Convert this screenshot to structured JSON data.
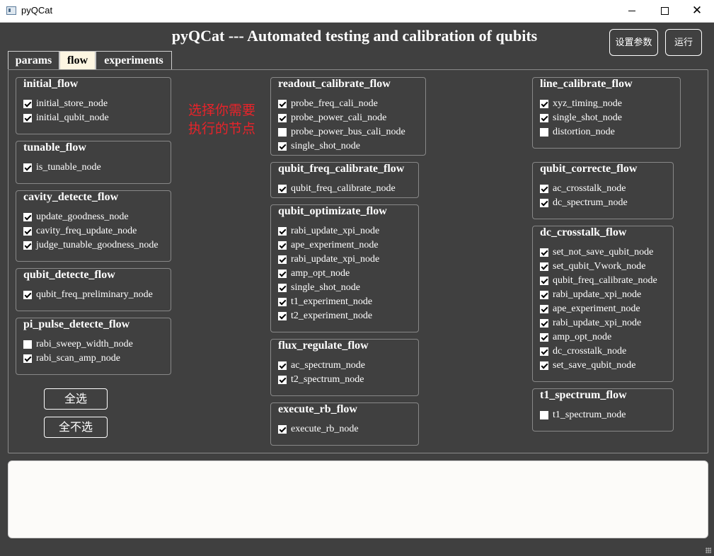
{
  "window": {
    "title": "pyQCat"
  },
  "header": {
    "title": "pyQCat --- Automated testing and calibration of qubits"
  },
  "toolbar": {
    "settings_label": "设置参数",
    "run_label": "运行"
  },
  "tabs": [
    {
      "label": "params",
      "active": false
    },
    {
      "label": "flow",
      "active": true
    },
    {
      "label": "experiments",
      "active": false
    }
  ],
  "hint_text": "选择你需要执行的节点",
  "buttons": {
    "select_all": "全选",
    "select_none": "全不选"
  },
  "groups": {
    "initial_flow": {
      "title": "initial_flow",
      "items": [
        {
          "label": "initial_store_node",
          "checked": true
        },
        {
          "label": "initial_qubit_node",
          "checked": true
        }
      ]
    },
    "tunable_flow": {
      "title": "tunable_flow",
      "items": [
        {
          "label": "is_tunable_node",
          "checked": true
        }
      ]
    },
    "cavity_detecte_flow": {
      "title": "cavity_detecte_flow",
      "items": [
        {
          "label": "update_goodness_node",
          "checked": true
        },
        {
          "label": "cavity_freq_update_node",
          "checked": true
        },
        {
          "label": "judge_tunable_goodness_node",
          "checked": true
        }
      ]
    },
    "qubit_detecte_flow": {
      "title": "qubit_detecte_flow",
      "items": [
        {
          "label": "qubit_freq_preliminary_node",
          "checked": true
        }
      ]
    },
    "pi_pulse_detecte_flow": {
      "title": "pi_pulse_detecte_flow",
      "items": [
        {
          "label": "rabi_sweep_width_node",
          "checked": false
        },
        {
          "label": "rabi_scan_amp_node",
          "checked": true
        }
      ]
    },
    "readout_calibrate_flow": {
      "title": "readout_calibrate_flow",
      "items": [
        {
          "label": "probe_freq_cali_node",
          "checked": true
        },
        {
          "label": "probe_power_cali_node",
          "checked": true
        },
        {
          "label": "probe_power_bus_cali_node",
          "checked": false
        },
        {
          "label": "single_shot_node",
          "checked": true
        }
      ]
    },
    "qubit_freq_calibrate_flow": {
      "title": "qubit_freq_calibrate_flow",
      "items": [
        {
          "label": "qubit_freq_calibrate_node",
          "checked": true
        }
      ]
    },
    "qubit_optimizate_flow": {
      "title": "qubit_optimizate_flow",
      "items": [
        {
          "label": "rabi_update_xpi_node",
          "checked": true
        },
        {
          "label": "ape_experiment_node",
          "checked": true
        },
        {
          "label": "rabi_update_xpi_node",
          "checked": true
        },
        {
          "label": "amp_opt_node",
          "checked": true
        },
        {
          "label": "single_shot_node",
          "checked": true
        },
        {
          "label": "t1_experiment_node",
          "checked": true
        },
        {
          "label": "t2_experiment_node",
          "checked": true
        }
      ]
    },
    "flux_regulate_flow": {
      "title": "flux_regulate_flow",
      "items": [
        {
          "label": "ac_spectrum_node",
          "checked": true
        },
        {
          "label": "t2_spectrum_node",
          "checked": true
        }
      ]
    },
    "execute_rb_flow": {
      "title": "execute_rb_flow",
      "items": [
        {
          "label": "execute_rb_node",
          "checked": true
        }
      ]
    },
    "line_calibrate_flow": {
      "title": "line_calibrate_flow",
      "items": [
        {
          "label": "xyz_timing_node",
          "checked": true
        },
        {
          "label": "single_shot_node",
          "checked": true
        },
        {
          "label": "distortion_node",
          "checked": false
        }
      ]
    },
    "qubit_correcte_flow": {
      "title": "qubit_correcte_flow",
      "items": [
        {
          "label": "ac_crosstalk_node",
          "checked": true
        },
        {
          "label": "dc_spectrum_node",
          "checked": true
        }
      ]
    },
    "dc_crosstalk_flow": {
      "title": "dc_crosstalk_flow",
      "items": [
        {
          "label": "set_not_save_qubit_node",
          "checked": true
        },
        {
          "label": "set_qubit_Vwork_node",
          "checked": true
        },
        {
          "label": "qubit_freq_calibrate_node",
          "checked": true
        },
        {
          "label": "rabi_update_xpi_node",
          "checked": true
        },
        {
          "label": "ape_experiment_node",
          "checked": true
        },
        {
          "label": "rabi_update_xpi_node",
          "checked": true
        },
        {
          "label": "amp_opt_node",
          "checked": true
        },
        {
          "label": "dc_crosstalk_node",
          "checked": true
        },
        {
          "label": "set_save_qubit_node",
          "checked": true
        }
      ]
    },
    "t1_spectrum_flow": {
      "title": "t1_spectrum_flow",
      "items": [
        {
          "label": "t1_spectrum_node",
          "checked": false
        }
      ]
    }
  },
  "log": {
    "text": ""
  }
}
